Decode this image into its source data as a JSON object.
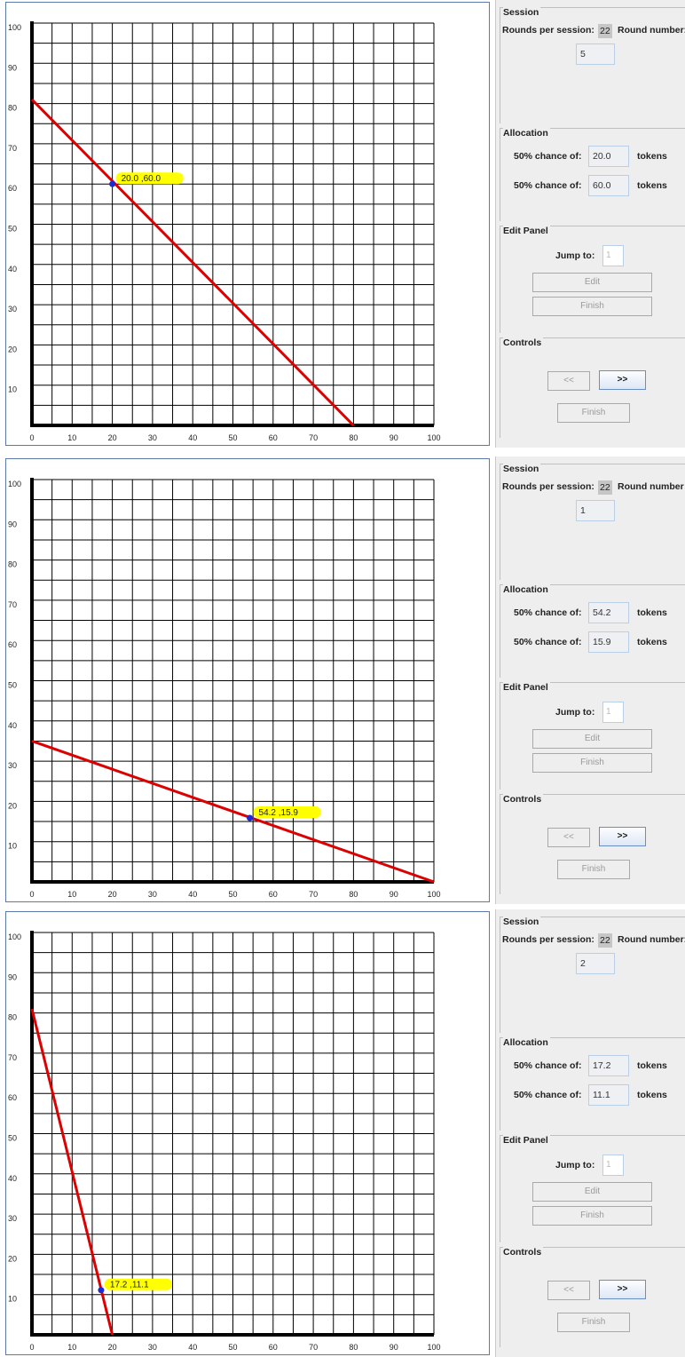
{
  "screens": [
    {
      "rounds_label": "Rounds per session:",
      "rounds_value": "22",
      "round_number_label": "Round number:",
      "round_number": "5",
      "session_title": "Session",
      "allocation_title": "Allocation",
      "alloc1_label": "50% chance of:",
      "alloc1_value": "20.0",
      "alloc1_unit": "tokens",
      "alloc2_label": "50% chance of:",
      "alloc2_value": "60.0",
      "alloc2_unit": "tokens",
      "edit_title": "Edit Panel",
      "jump_label": "Jump to:",
      "jump_value": "1",
      "edit_button": "Edit",
      "finish_edit_button": "Finish",
      "controls_title": "Controls",
      "prev_button": "<<",
      "next_button": ">>",
      "finish_button": "Finish",
      "point_label": "20.0  ,60.0"
    },
    {
      "rounds_label": "Rounds per session:",
      "rounds_value": "22",
      "round_number_label": "Round number",
      "round_number": "1",
      "session_title": "Session",
      "allocation_title": "Allocation",
      "alloc1_label": "50% chance of:",
      "alloc1_value": "54.2",
      "alloc1_unit": "tokens",
      "alloc2_label": "50% chance of:",
      "alloc2_value": "15.9",
      "alloc2_unit": "tokens",
      "edit_title": "Edit Panel",
      "jump_label": "Jump to:",
      "jump_value": "1",
      "edit_button": "Edit",
      "finish_edit_button": "Finish",
      "controls_title": "Controls",
      "prev_button": "<<",
      "next_button": ">>",
      "finish_button": "Finish",
      "point_label": "54.2  ,15.9"
    },
    {
      "rounds_label": "Rounds per session:",
      "rounds_value": "22",
      "round_number_label": "Round number:",
      "round_number": "2",
      "session_title": "Session",
      "allocation_title": "Allocation",
      "alloc1_label": "50% chance of:",
      "alloc1_value": "17.2",
      "alloc1_unit": "tokens",
      "alloc2_label": "50% chance of:",
      "alloc2_value": "11.1",
      "alloc2_unit": "tokens",
      "edit_title": "Edit Panel",
      "jump_label": "Jump to:",
      "jump_value": "1",
      "edit_button": "Edit",
      "finish_edit_button": "Finish",
      "controls_title": "Controls",
      "prev_button": "<<",
      "next_button": ">>",
      "finish_button": "Finish",
      "point_label": "17.2  ,11.1"
    }
  ],
  "chart_data": [
    {
      "type": "line",
      "xlim": [
        0,
        100
      ],
      "ylim": [
        0,
        100
      ],
      "x_ticks": [
        "0",
        "10",
        "20",
        "30",
        "40",
        "50",
        "60",
        "70",
        "80",
        "90",
        "100"
      ],
      "y_ticks": [
        "10",
        "20",
        "30",
        "40",
        "50",
        "60",
        "70",
        "80",
        "90",
        "100"
      ],
      "grid": true,
      "series": [
        {
          "x": [
            0,
            80
          ],
          "y": [
            81,
            0
          ]
        }
      ],
      "point": {
        "x": 20.0,
        "y": 60.0
      },
      "colors": {
        "line": "#dd0000",
        "point": "#1a2bd6",
        "label_bg": "#ffff00"
      }
    },
    {
      "type": "line",
      "xlim": [
        0,
        100
      ],
      "ylim": [
        0,
        100
      ],
      "x_ticks": [
        "0",
        "10",
        "20",
        "30",
        "40",
        "50",
        "60",
        "70",
        "80",
        "90",
        "100"
      ],
      "y_ticks": [
        "10",
        "20",
        "30",
        "40",
        "50",
        "60",
        "70",
        "80",
        "90",
        "100"
      ],
      "grid": true,
      "series": [
        {
          "x": [
            0,
            100
          ],
          "y": [
            35,
            0
          ]
        }
      ],
      "point": {
        "x": 54.2,
        "y": 15.9
      },
      "colors": {
        "line": "#dd0000",
        "point": "#1a2bd6",
        "label_bg": "#ffff00"
      }
    },
    {
      "type": "line",
      "xlim": [
        0,
        100
      ],
      "ylim": [
        0,
        100
      ],
      "x_ticks": [
        "0",
        "10",
        "20",
        "30",
        "40",
        "50",
        "60",
        "70",
        "80",
        "90",
        "100"
      ],
      "y_ticks": [
        "10",
        "20",
        "30",
        "40",
        "50",
        "60",
        "70",
        "80",
        "90",
        "100"
      ],
      "grid": true,
      "series": [
        {
          "x": [
            0,
            20
          ],
          "y": [
            81,
            0
          ]
        }
      ],
      "point": {
        "x": 17.2,
        "y": 11.1
      },
      "colors": {
        "line": "#dd0000",
        "point": "#1a2bd6",
        "label_bg": "#ffff00"
      }
    }
  ]
}
